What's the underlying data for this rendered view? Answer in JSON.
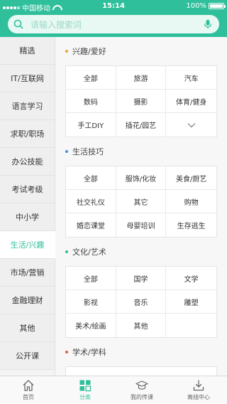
{
  "status_bar": {
    "carrier": "中国移动",
    "time": "15:14",
    "battery": "100%",
    "battery_level": 1.0
  },
  "search": {
    "placeholder": "请输入搜索词"
  },
  "sidebar": {
    "items": [
      {
        "label": "精选"
      },
      {
        "label": "IT/互联网"
      },
      {
        "label": "语言学习"
      },
      {
        "label": "求职/职场"
      },
      {
        "label": "办公技能"
      },
      {
        "label": "考试考级"
      },
      {
        "label": "中小学"
      },
      {
        "label": "生活/兴趣"
      },
      {
        "label": "市场/营销"
      },
      {
        "label": "金融理财"
      },
      {
        "label": "其他"
      },
      {
        "label": "公开课"
      }
    ],
    "active_index": 7
  },
  "sections": [
    {
      "title": "兴趣/爱好",
      "dot_color": "#f0a033",
      "items": [
        "全部",
        "旅游",
        "汽车",
        "数码",
        "摄影",
        "体育/健身",
        "手工DIY",
        "插花/园艺"
      ],
      "has_expand": true
    },
    {
      "title": "生活技巧",
      "dot_color": "#4a90d9",
      "items": [
        "全部",
        "服饰/化妆",
        "美食/厨艺",
        "社交礼仪",
        "其它",
        "购物",
        "婚恋课堂",
        "母婴培训",
        "生存逃生"
      ]
    },
    {
      "title": "文化/艺术",
      "dot_color": "#2fbf9b",
      "items": [
        "全部",
        "国学",
        "文学",
        "影视",
        "音乐",
        "雕塑",
        "美术/绘画",
        "其他"
      ]
    },
    {
      "title": "学术/学科",
      "dot_color": "#e05a4f",
      "items": []
    }
  ],
  "tabbar": {
    "tabs": [
      {
        "label": "首页"
      },
      {
        "label": "分类"
      },
      {
        "label": "我的传课"
      },
      {
        "label": "离线中心"
      }
    ],
    "active_index": 1
  },
  "colors": {
    "accent": "#2fbf9b",
    "search_bg": "#e8f8f3"
  }
}
